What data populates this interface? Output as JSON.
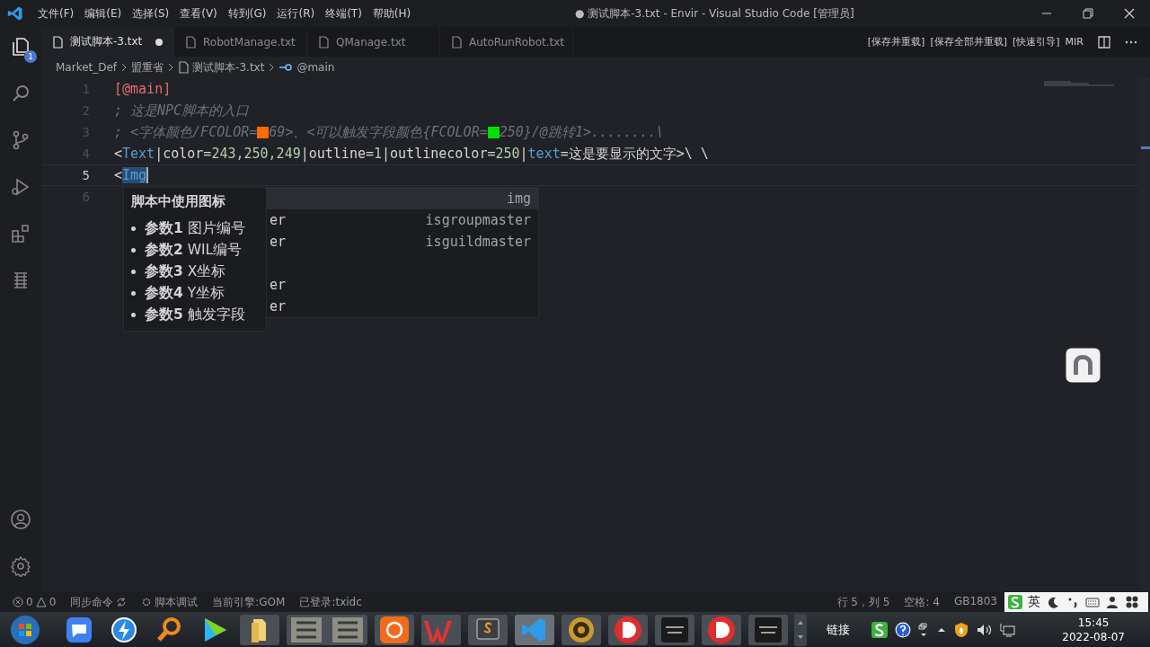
{
  "window": {
    "title": "● 测试脚本-3.txt - Envir - Visual Studio Code [管理员]"
  },
  "menu": [
    "文件(F)",
    "编辑(E)",
    "选择(S)",
    "查看(V)",
    "转到(G)",
    "运行(R)",
    "终端(T)",
    "帮助(H)"
  ],
  "activity": [
    {
      "kind": "files",
      "selected": true,
      "badge": "1"
    },
    {
      "kind": "search",
      "selected": false
    },
    {
      "kind": "source",
      "selected": false
    },
    {
      "kind": "run",
      "selected": false
    },
    {
      "kind": "extensions",
      "selected": false
    },
    {
      "kind": "glyph",
      "selected": false
    }
  ],
  "activity_bottom": [
    {
      "kind": "account"
    },
    {
      "kind": "settings"
    }
  ],
  "tabs": [
    {
      "label": "测试脚本-3.txt",
      "selected": true,
      "dirty": true
    },
    {
      "label": "RobotManage.txt",
      "selected": false,
      "dirty": false
    },
    {
      "label": "QManage.txt",
      "selected": false,
      "dirty": false
    },
    {
      "label": "AutoRunRobot.txt",
      "selected": false,
      "dirty": false
    }
  ],
  "editor_actions": [
    "[保存并重载]",
    "[保存全部并重载]",
    "[快速引导]",
    "MIR"
  ],
  "breadcrumb": [
    {
      "kind": "folder",
      "label": "Market_Def"
    },
    {
      "kind": "folder",
      "label": "盟重省"
    },
    {
      "kind": "file",
      "label": "测试脚本-3.txt"
    },
    {
      "kind": "symbol",
      "label": "@main"
    }
  ],
  "code": [
    {
      "number": "1",
      "current": false,
      "tokens": [
        {
          "kind": "section",
          "text": "[@main]"
        }
      ]
    },
    {
      "number": "2",
      "current": false,
      "tokens": [
        {
          "kind": "comment",
          "text": "; 这是NPC脚本的入口"
        }
      ]
    },
    {
      "number": "3",
      "current": false,
      "tokens": [
        {
          "kind": "comment",
          "text": "; <字体颜色/FCOLOR="
        },
        {
          "kind": "swatch",
          "color": "#ff6a00"
        },
        {
          "kind": "comment",
          "text": "69>、<可以触发字段颜色{FCOLOR="
        },
        {
          "kind": "swatch",
          "color": "#00e000"
        },
        {
          "kind": "comment",
          "text": "250}/@跳转1>........\\"
        }
      ]
    },
    {
      "number": "4",
      "current": false,
      "tokens": [
        {
          "kind": "plain",
          "text": "<"
        },
        {
          "kind": "tag",
          "text": "Text"
        },
        {
          "kind": "plain",
          "text": "|color="
        },
        {
          "kind": "number",
          "text": "243,250,249"
        },
        {
          "kind": "plain",
          "text": "|outline="
        },
        {
          "kind": "number",
          "text": "1"
        },
        {
          "kind": "plain",
          "text": "|outlinecolor="
        },
        {
          "kind": "number",
          "text": "250"
        },
        {
          "kind": "plain",
          "text": "|"
        },
        {
          "kind": "tag",
          "text": "text"
        },
        {
          "kind": "plain",
          "text": "=这是要显示的文字>\\ \\"
        }
      ]
    },
    {
      "number": "5",
      "current": true,
      "tokens": [
        {
          "kind": "plain",
          "text": "<"
        },
        {
          "kind": "match",
          "text": "Img"
        }
      ]
    },
    {
      "number": "6",
      "current": false
    }
  ],
  "suggest": [
    {
      "right": "img",
      "selected": true
    },
    {
      "left": "er",
      "right": "isgroupmaster",
      "selected": false
    },
    {
      "left": "er",
      "right": "isguildmaster",
      "selected": false
    },
    {
      "selected": false
    },
    {
      "left": "er",
      "selected": false
    },
    {
      "left": "er",
      "selected": false
    }
  ],
  "hover": {
    "title": "脚本中使用图标",
    "params": [
      "**参数1** 图片编号",
      "**参数2** WIL编号",
      "**参数3** X坐标",
      "**参数4** Y坐标",
      "**参数5** 触发字段"
    ]
  },
  "status_bar": {
    "errors": "0",
    "warnings": "0",
    "items": [
      {
        "kind": "sync",
        "text": "同步命令"
      },
      {
        "kind": "debug",
        "text": "脚本调试"
      },
      {
        "kind": "plain",
        "text": "当前引擎:GOM"
      },
      {
        "kind": "plain",
        "text": "已登录:txidc"
      }
    ],
    "right": [
      "行 5，列 5",
      "空格: 4",
      "GB1803"
    ]
  },
  "ime": {
    "label": "英"
  },
  "taskbar": {
    "link": "链接",
    "time": "15:45",
    "date": "2022-08-07"
  }
}
